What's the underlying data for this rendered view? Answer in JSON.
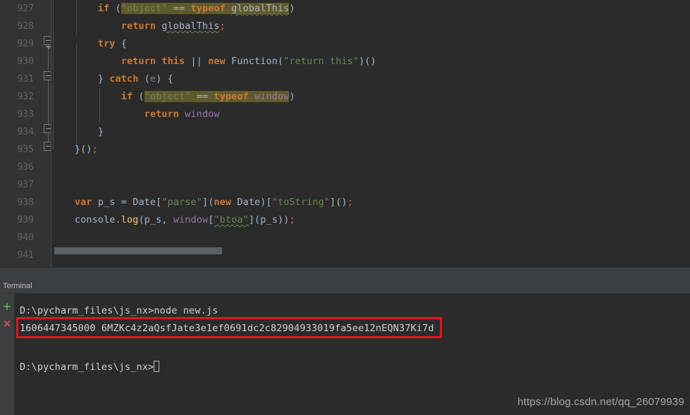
{
  "editor": {
    "first_line_number": 927,
    "line_numbers": [
      927,
      928,
      929,
      930,
      931,
      932,
      933,
      934,
      935,
      936,
      937,
      938,
      939,
      940,
      941
    ],
    "lines": [
      {
        "n": 927,
        "text": "        if (\"object\" == typeof globalThis)"
      },
      {
        "n": 928,
        "text": "            return globalThis;"
      },
      {
        "n": 929,
        "text": "        try {"
      },
      {
        "n": 930,
        "text": "            return this || new Function(\"return this\")()"
      },
      {
        "n": 931,
        "text": "        } catch (e) {"
      },
      {
        "n": 932,
        "text": "            if (\"object\" == typeof window)"
      },
      {
        "n": 933,
        "text": "                return window"
      },
      {
        "n": 934,
        "text": "        }"
      },
      {
        "n": 935,
        "text": "    }();"
      },
      {
        "n": 936,
        "text": ""
      },
      {
        "n": 937,
        "text": ""
      },
      {
        "n": 938,
        "text": "    var p_s = Date[\"parse\"](new Date)[\"toString\"]();"
      },
      {
        "n": 939,
        "text": "    console.log(p_s, window[\"btoa\"](p_s));"
      },
      {
        "n": 940,
        "text": ""
      },
      {
        "n": 941,
        "text": ""
      }
    ],
    "tokens": {
      "kw_if": "if",
      "kw_return": "return",
      "kw_try": "try",
      "kw_catch": "catch",
      "kw_new": "new",
      "kw_typeof": "typeof",
      "kw_var": "var",
      "str_object": "\"object\"",
      "str_return_this": "\"return this\"",
      "str_parse": "\"parse\"",
      "str_toString": "\"toString\"",
      "str_btoa": "\"btoa\"",
      "id_globalThis": "globalThis",
      "id_window": "window",
      "id_this": "this",
      "id_Function": "Function",
      "id_Date": "Date",
      "id_console": "console",
      "id_log": "log",
      "id_p_s": "p_s",
      "id_e": "e"
    },
    "colors": {
      "background": "#2b2b2b",
      "gutter_background": "#313335",
      "line_number": "#606366",
      "default_text": "#a9b7c6",
      "keyword": "#cc7832",
      "string": "#6a8759",
      "function": "#ffc66d",
      "global_variable": "#9876aa",
      "highlight": "#5f5a2e"
    }
  },
  "terminal": {
    "tab_label": "Terminal",
    "buttons": {
      "new_session": "+",
      "close_session": "×"
    },
    "lines": [
      {
        "id": "prompt-1",
        "text": "D:\\pycharm_files\\js_nx>node new.js"
      },
      {
        "id": "output-1",
        "text": "1606447345000 6MZKc4z2aQsfJate3e1ef0691dc2c82904933019fa5ee12nEQN37Ki7d"
      },
      {
        "id": "prompt-2",
        "text": "D:\\pycharm_files\\js_nx>"
      }
    ],
    "output_values": {
      "timestamp": "1606447345000",
      "encoded": "6MZKc4z2aQsfJate3e1ef0691dc2c82904933019fa5ee12nEQN37Ki7d"
    },
    "colors": {
      "background": "#2b2b2b",
      "panel": "#3c3f41",
      "text": "#cfd2d5",
      "plus": "#57a64a",
      "close": "#d9534f",
      "annotation_box": "#e81123"
    }
  },
  "watermark": {
    "text": "https://blog.csdn.net/qq_26079939"
  }
}
